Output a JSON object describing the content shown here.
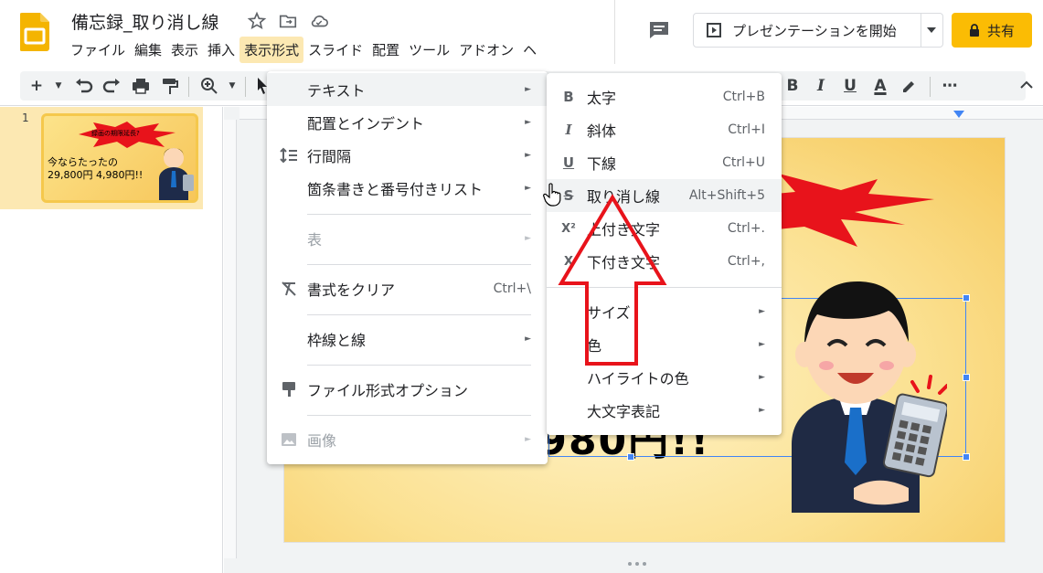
{
  "title_bar": {
    "doc_title": "備忘録_取り消し線",
    "present_label": "プレゼンテーションを開始",
    "share_label": "共有"
  },
  "menubar": {
    "items": [
      "ファイル",
      "編集",
      "表示",
      "挿入",
      "表示形式",
      "スライド",
      "配置",
      "ツール",
      "アドオン",
      "ヘ"
    ],
    "active": "表示形式"
  },
  "toolbar": {
    "icons": [
      "add-icon",
      "undo-icon",
      "redo-icon",
      "print-icon",
      "paint-format-icon",
      "zoom-icon",
      "select-icon",
      "bold-icon",
      "italic-icon",
      "underline-icon",
      "text-color-icon",
      "highlight-icon",
      "more-icon",
      "collapse-icon"
    ],
    "bold_glyph": "B",
    "italic_glyph": "I",
    "underline_glyph": "U",
    "text_color_glyph": "A",
    "more_glyph": "⋯"
  },
  "filmstrip": {
    "slide_number": "1",
    "thumb_badge": "録画の期限延長?",
    "thumb_text": "今ならたったの\n29,800円 4,980円!!"
  },
  "slide": {
    "body_text": "4,980円!!"
  },
  "format_menu": {
    "items": [
      {
        "label": "テキスト",
        "icon": "",
        "arrow": "►",
        "shortcut": ""
      },
      {
        "label": "配置とインデント",
        "icon": "",
        "arrow": "►",
        "shortcut": ""
      },
      {
        "label": "行間隔",
        "icon": "line-spacing-icon",
        "arrow": "►",
        "shortcut": ""
      },
      {
        "label": "箇条書きと番号付きリスト",
        "icon": "",
        "arrow": "►",
        "shortcut": ""
      },
      {
        "label": "表",
        "icon": "",
        "arrow": "►",
        "shortcut": ""
      },
      {
        "label": "書式をクリア",
        "icon": "clear-format-icon",
        "arrow": "",
        "shortcut": "Ctrl+\\"
      },
      {
        "label": "枠線と線",
        "icon": "",
        "arrow": "►",
        "shortcut": ""
      },
      {
        "label": "ファイル形式オプション",
        "icon": "format-options-icon",
        "arrow": "",
        "shortcut": ""
      },
      {
        "label": "画像",
        "icon": "image-icon",
        "arrow": "►",
        "shortcut": ""
      }
    ]
  },
  "text_submenu": {
    "items": [
      {
        "label": "太字",
        "glyph": "B",
        "shortcut": "Ctrl+B"
      },
      {
        "label": "斜体",
        "glyph": "I",
        "shortcut": "Ctrl+I"
      },
      {
        "label": "下線",
        "glyph": "U",
        "shortcut": "Ctrl+U"
      },
      {
        "label": "取り消し線",
        "glyph": "S",
        "shortcut": "Alt+Shift+5"
      },
      {
        "label": "上付き文字",
        "glyph": "X²",
        "shortcut": "Ctrl+."
      },
      {
        "label": "下付き文字",
        "glyph": "X",
        "shortcut": "Ctrl+,"
      },
      {
        "label": "サイズ",
        "glyph": "",
        "shortcut": "►"
      },
      {
        "label": "色",
        "glyph": "",
        "shortcut": "►"
      },
      {
        "label": "ハイライトの色",
        "glyph": "",
        "shortcut": "►"
      },
      {
        "label": "大文字表記",
        "glyph": "",
        "shortcut": "►"
      }
    ]
  },
  "colors": {
    "accent_yellow": "#fbbc04",
    "menu_active_bg": "#fce8b2",
    "annotation_red": "#e8131b",
    "selection_blue": "#4285f4"
  }
}
